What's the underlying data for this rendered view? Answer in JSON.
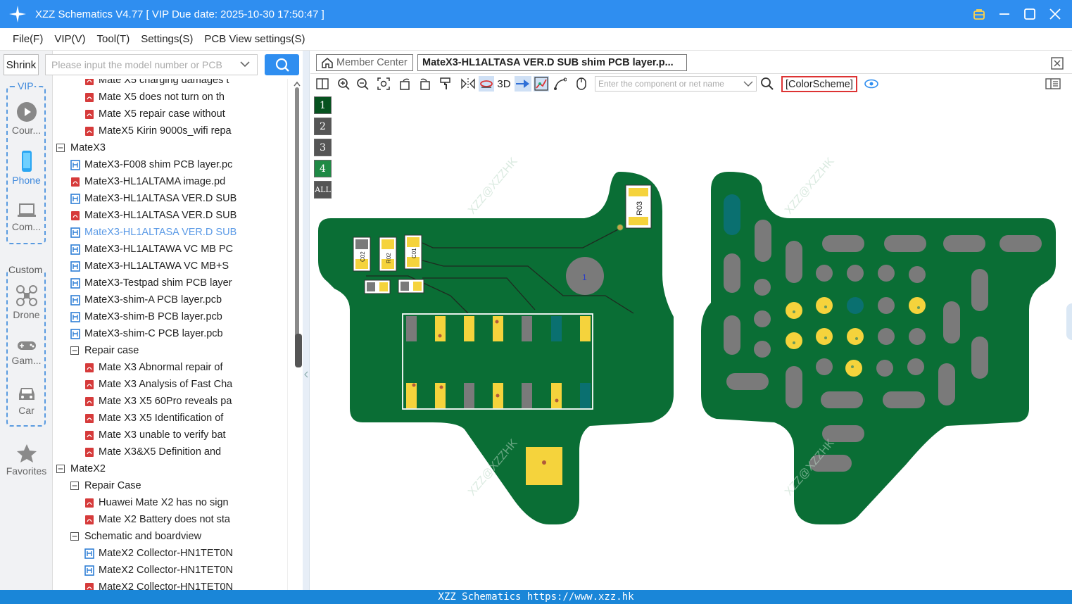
{
  "app": {
    "title": "XZZ Schematics V4.77 [ VIP Due date: 2025-10-30 17:50:47 ]"
  },
  "menu": [
    "File(F)",
    "VIP(V)",
    "Tool(T)",
    "Settings(S)",
    "PCB View settings(S)"
  ],
  "left": {
    "shrink": "Shrink",
    "vip_label": "VIP",
    "custom_label": "Custom",
    "categories": [
      "Cour...",
      "Phone",
      "Com...",
      "Drone",
      "Gam...",
      "Car",
      "Favorites"
    ]
  },
  "search": {
    "placeholder": "Please input the model number or PCB"
  },
  "tree": [
    {
      "label": "Mate X5 charging damages t",
      "icon": "pdf"
    },
    {
      "label": "Mate X5 does not turn on th",
      "icon": "pdf"
    },
    {
      "label": "Mate X5 repair case without",
      "icon": "pdf"
    },
    {
      "label": "MateX5 Kirin 9000s_wifi repa",
      "icon": "pdf"
    },
    {
      "label": "MateX3",
      "icon": "folder"
    },
    {
      "label": "MateX3-F008 shim PCB layer.pc",
      "icon": "pcb"
    },
    {
      "label": "MateX3-HL1ALTAMA image.pd",
      "icon": "pdf"
    },
    {
      "label": "MateX3-HL1ALTASA VER.D SUB",
      "icon": "pcb"
    },
    {
      "label": "MateX3-HL1ALTASA VER.D SUB",
      "icon": "pdf"
    },
    {
      "label": "MateX3-HL1ALTASA VER.D SUB",
      "icon": "pcb"
    },
    {
      "label": "MateX3-HL1ALTAWA VC MB PC",
      "icon": "pcb"
    },
    {
      "label": "MateX3-HL1ALTAWA VC MB+S",
      "icon": "pcb"
    },
    {
      "label": "MateX3-Testpad shim PCB layer",
      "icon": "pcb"
    },
    {
      "label": "MateX3-shim-A PCB layer.pcb",
      "icon": "pcb"
    },
    {
      "label": "MateX3-shim-B PCB layer.pcb",
      "icon": "pcb"
    },
    {
      "label": "MateX3-shim-C PCB layer.pcb",
      "icon": "pcb"
    },
    {
      "label": "Repair case",
      "icon": "folder"
    },
    {
      "label": "Mate X3 Abnormal repair of",
      "icon": "pdf"
    },
    {
      "label": "Mate X3 Analysis of Fast Cha",
      "icon": "pdf"
    },
    {
      "label": "Mate X3 X5 60Pro reveals pa",
      "icon": "pdf"
    },
    {
      "label": "Mate X3 X5 Identification of",
      "icon": "pdf"
    },
    {
      "label": "Mate X3 unable to verify bat",
      "icon": "pdf"
    },
    {
      "label": "Mate X3&X5 Definition and",
      "icon": "pdf"
    },
    {
      "label": "MateX2",
      "icon": "folder"
    },
    {
      "label": "Repair Case",
      "icon": "folder"
    },
    {
      "label": "Huawei Mate X2 has no sign",
      "icon": "pdf"
    },
    {
      "label": "Mate X2 Battery does not sta",
      "icon": "pdf"
    },
    {
      "label": "Schematic and boardview",
      "icon": "folder"
    },
    {
      "label": "MateX2 Collector-HN1TET0N",
      "icon": "pcb"
    },
    {
      "label": "MateX2 Collector-HN1TET0N",
      "icon": "pcb"
    },
    {
      "label": "MateX2 Collector-HN1TET0N",
      "icon": "pdf"
    }
  ],
  "tabs": {
    "member": "Member Center",
    "active": "MateX3-HL1ALTASA VER.D SUB shim PCB layer.p..."
  },
  "toolbar": {
    "three_d": "3D",
    "comp_placeholder": "Enter the component or net name",
    "colorscheme": "[ColorScheme]"
  },
  "layers": [
    "1",
    "2",
    "3",
    "4",
    "ALL"
  ],
  "pcb": {
    "labels": {
      "r03": "R03",
      "c02": "C02",
      "r02": "R02",
      "c01": "C01",
      "pad1": "1"
    },
    "watermark": "XZZ@XZZHK",
    "colors": {
      "board": "#0a6e35",
      "gold": "#f5d33c",
      "gray": "#7a7a7a",
      "teal": "#0a7070"
    }
  },
  "status": "XZZ Schematics https://www.xzz.hk"
}
